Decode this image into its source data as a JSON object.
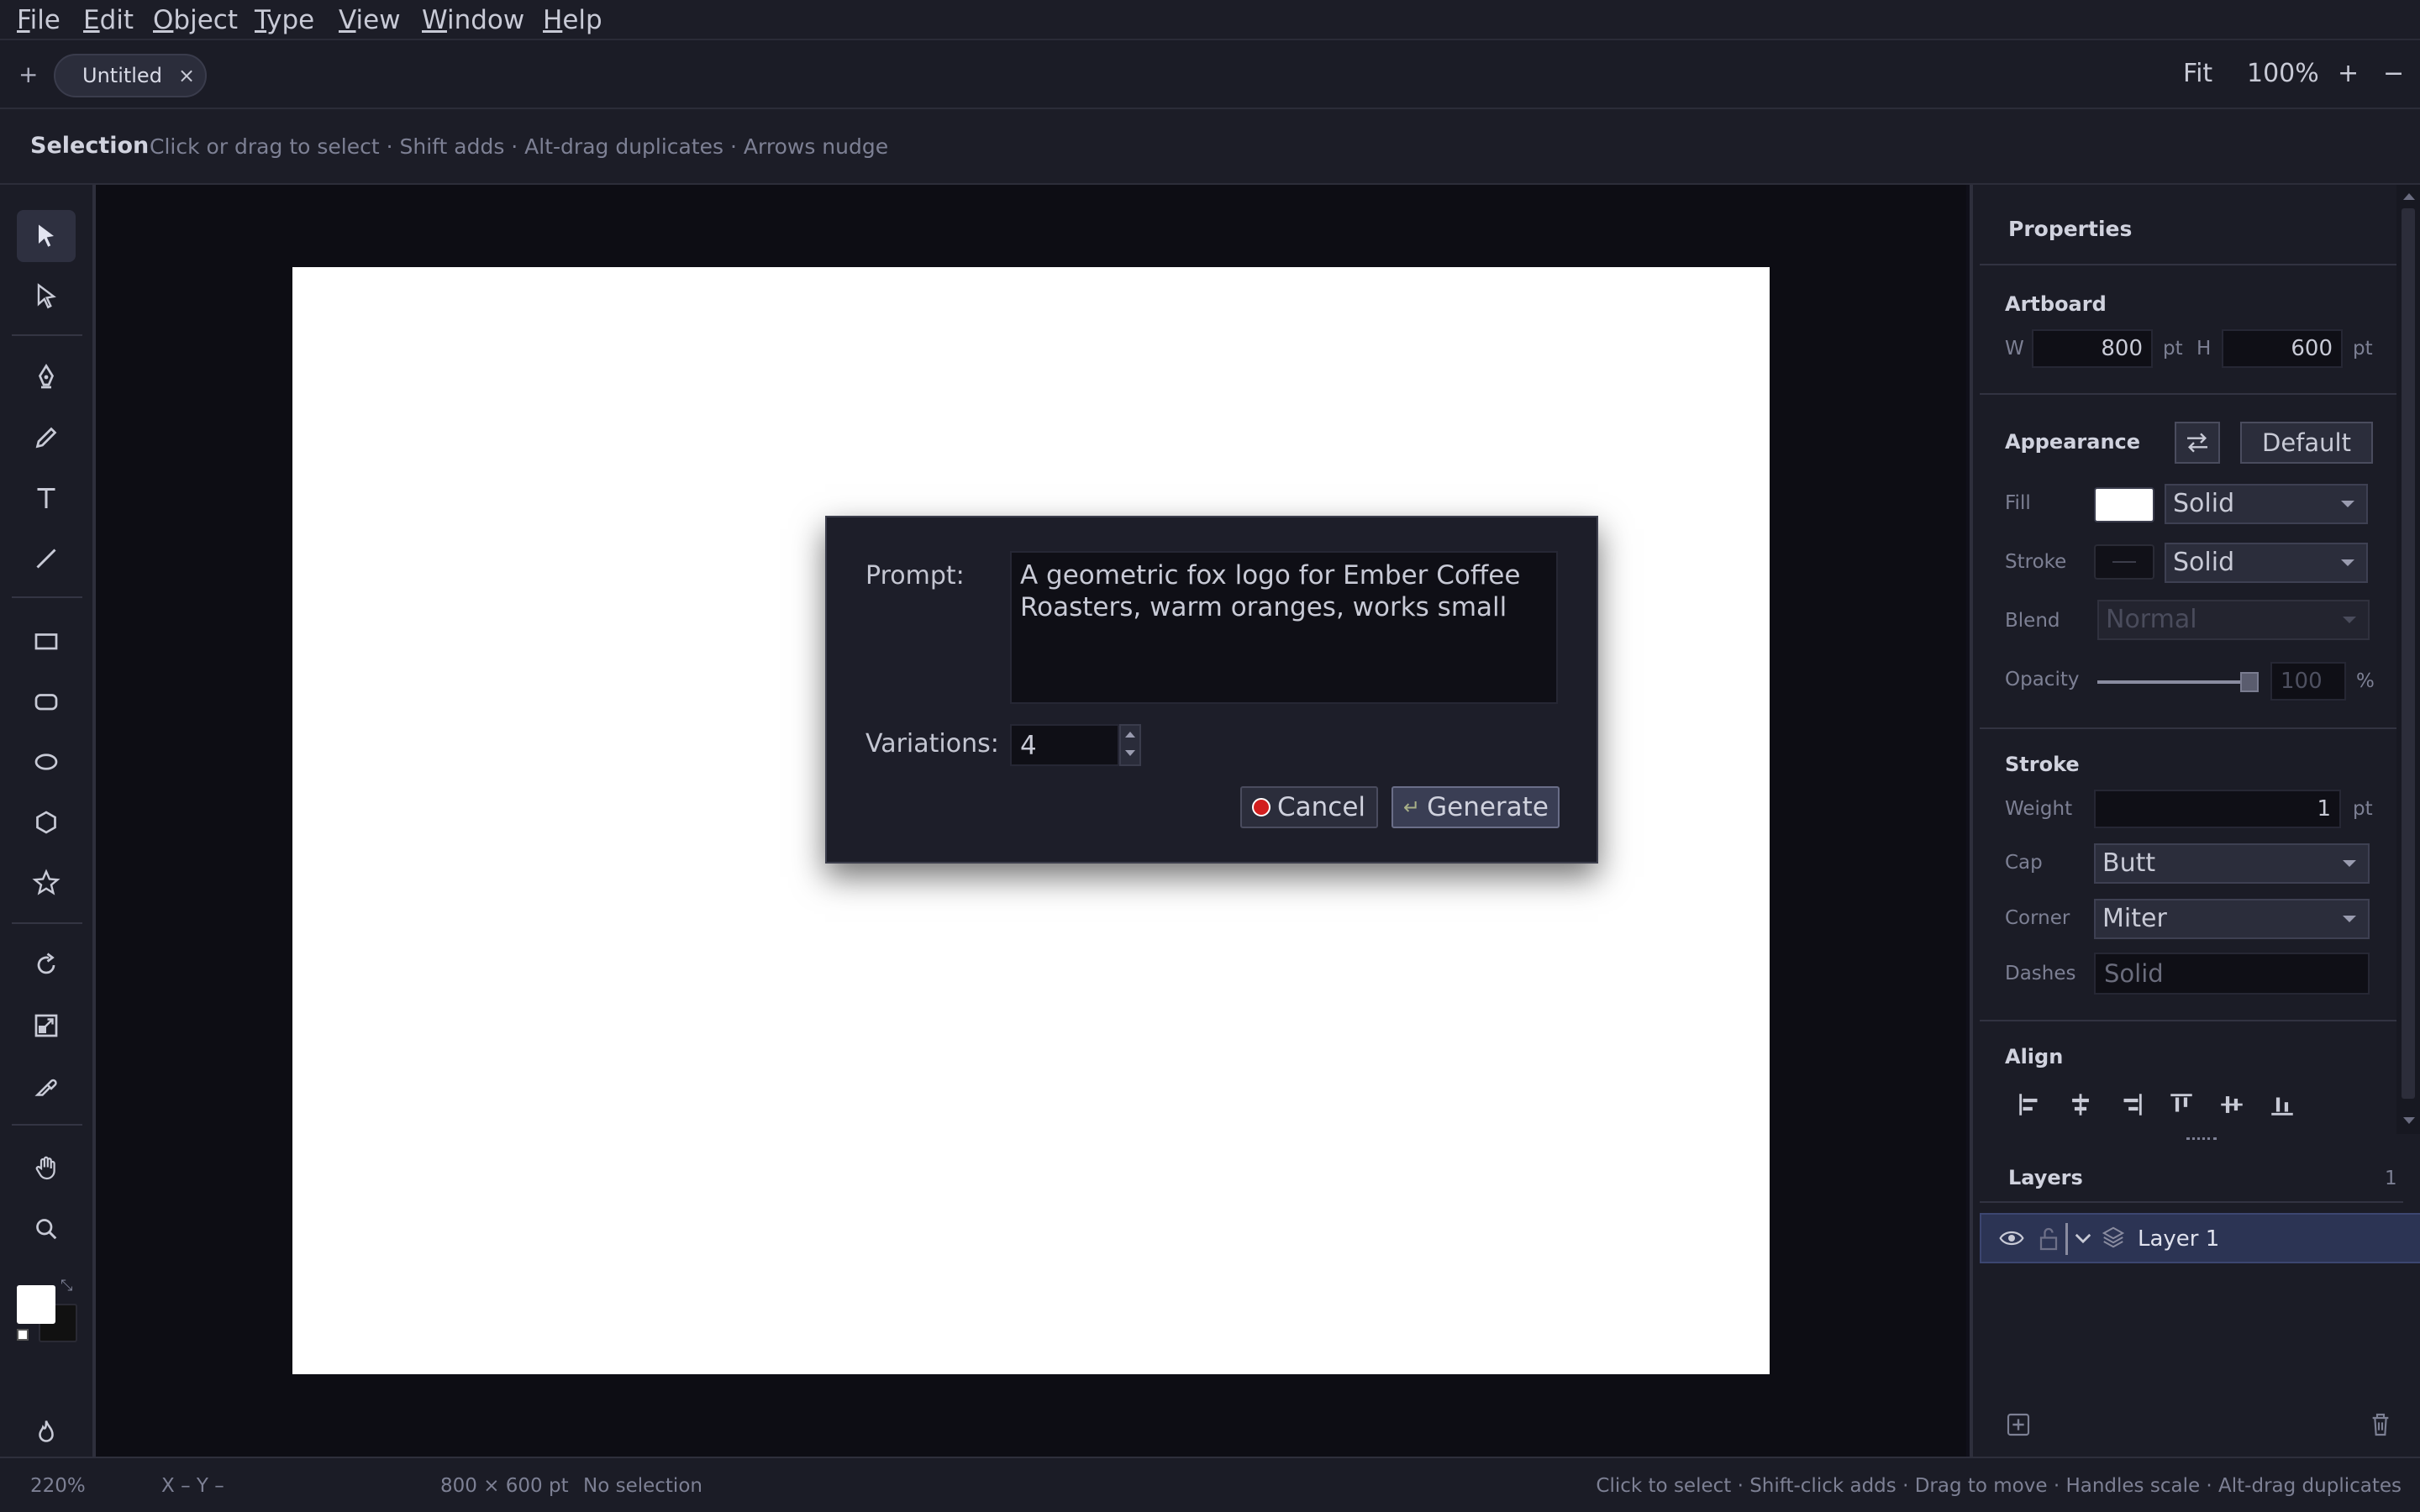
{
  "menubar": {
    "items": [
      "File",
      "Edit",
      "Object",
      "Type",
      "View",
      "Window",
      "Help"
    ]
  },
  "tabs": {
    "new_label": "+",
    "doc_tab_label": "Untitled",
    "close_label": "×",
    "fit_label": "Fit",
    "zoom_label": "100%",
    "zoom_in_label": "+",
    "zoom_out_label": "−"
  },
  "hintbar": {
    "tool_name": "Selection",
    "hint": "Click or drag to select · Shift adds · Alt-drag duplicates · Arrows nudge"
  },
  "toolbar": {
    "tools": [
      "selection-tool",
      "direct-selection-tool",
      "pen-tool",
      "pencil-tool",
      "text-tool",
      "line-tool",
      "rectangle-tool",
      "rounded-rectangle-tool",
      "ellipse-tool",
      "polygon-tool",
      "star-tool",
      "rotate-tool",
      "scale-tool",
      "eyedropper-tool",
      "hand-tool",
      "zoom-tool",
      "flame-tool"
    ],
    "active_tool": "selection-tool",
    "fill_color": "#ffffff",
    "stroke_color": "#111111"
  },
  "dialog": {
    "prompt_label": "Prompt:",
    "prompt_value": "A geometric fox logo for Ember Coffee Roasters, warm oranges, works small",
    "variations_label": "Variations:",
    "variations_value": "4",
    "cancel_label": "Cancel",
    "generate_label": "Generate"
  },
  "properties": {
    "title": "Properties",
    "artboard": {
      "heading": "Artboard",
      "w_label": "W",
      "w_value": "800",
      "w_unit": "pt",
      "h_label": "H",
      "h_value": "600",
      "h_unit": "pt"
    },
    "appearance": {
      "heading": "Appearance",
      "default_label": "Default",
      "fill_label": "Fill",
      "fill_type": "Solid",
      "fill_color": "#ffffff",
      "stroke_label": "Stroke",
      "stroke_type": "Solid",
      "blend_label": "Blend",
      "blend_value": "Normal",
      "opacity_label": "Opacity",
      "opacity_value": "100",
      "opacity_unit": "%"
    },
    "stroke": {
      "heading": "Stroke",
      "weight_label": "Weight",
      "weight_value": "1",
      "weight_unit": "pt",
      "cap_label": "Cap",
      "cap_value": "Butt",
      "corner_label": "Corner",
      "corner_value": "Miter",
      "dashes_label": "Dashes",
      "dashes_value": "Solid"
    },
    "align": {
      "heading": "Align"
    },
    "layers": {
      "heading": "Layers",
      "count": "1",
      "items": [
        {
          "name": "Layer 1"
        }
      ]
    }
  },
  "statusbar": {
    "zoom": "220%",
    "coords": "X –  Y –",
    "size": "800 × 600 pt",
    "selection": "No selection",
    "hint": "Click to select · Shift-click adds · Drag to move · Handles scale · Alt-drag duplicates"
  }
}
